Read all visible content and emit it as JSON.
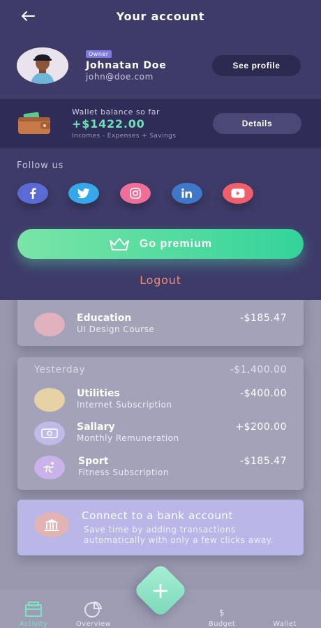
{
  "header": {
    "title": "Your account"
  },
  "profile": {
    "badge": "Owner",
    "name": "Johnatan Doe",
    "email": "john@doe.com",
    "see_profile_label": "See profile"
  },
  "wallet": {
    "caption": "Wallet balance so far",
    "amount": "+$1422.00",
    "subtitle": "Incomes - Expenses + Savings",
    "details_label": "Details"
  },
  "follow": {
    "label": "Follow us",
    "networks": [
      "facebook-icon",
      "twitter-icon",
      "instagram-icon",
      "linkedin-icon",
      "youtube-icon"
    ]
  },
  "premium": {
    "label": "Go premium"
  },
  "logout": {
    "label": "Logout"
  },
  "background": {
    "first_card": {
      "name": "Education",
      "sub": "UI Design Course",
      "amount": "-$185.47"
    },
    "yesterday": {
      "label": "Yesterday",
      "total": "-$1,400.00",
      "items": [
        {
          "name": "Utilities",
          "sub": "Internet Subscription",
          "amount": "-$400.00",
          "color": "#e6d2a5"
        },
        {
          "name": "Sallary",
          "sub": "Monthly Remuneration",
          "amount": "+$200.00",
          "color": "#c0bae8"
        },
        {
          "name": "Sport",
          "sub": "Fitness Subscription",
          "amount": "-$185.47",
          "color": "#c9b3ea"
        }
      ]
    },
    "bank": {
      "title": "Connect to a bank account",
      "subtitle": "Save time by adding transactions automatically with only a few clicks away."
    }
  },
  "nav": {
    "activity": "Activity",
    "overview": "Overview",
    "budget": "Budget",
    "wallet": "Wallet",
    "budget_symbol": "$"
  },
  "colors": {
    "panel": "#3e3b69",
    "accent_green": "#69e5b5",
    "logout": "#f08d79"
  }
}
